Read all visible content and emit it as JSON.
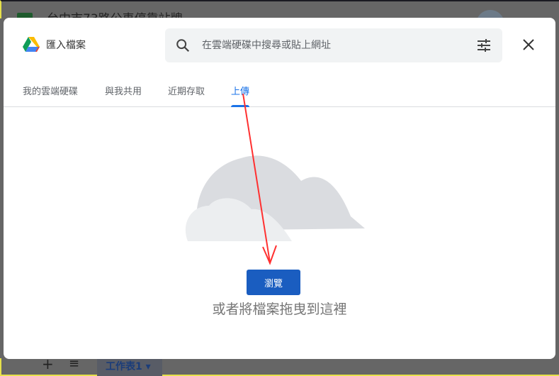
{
  "background": {
    "document_title": "台中市73路公車停靠站牌",
    "sheet_tab": "工作表1",
    "add_sheet": "+",
    "all_sheets": "≡"
  },
  "dialog": {
    "title": "匯入檔案",
    "search_placeholder": "在雲端硬碟中搜尋或貼上網址",
    "tabs": [
      {
        "label": "我的雲端硬碟",
        "active": false
      },
      {
        "label": "與我共用",
        "active": false
      },
      {
        "label": "近期存取",
        "active": false
      },
      {
        "label": "上傳",
        "active": true
      }
    ],
    "browse_button": "瀏覽",
    "drop_text": "或者將檔案拖曳到這裡"
  },
  "colors": {
    "accent": "#1a73e8",
    "button": "#1a5dc0",
    "annotation_arrow": "#ff3030"
  }
}
